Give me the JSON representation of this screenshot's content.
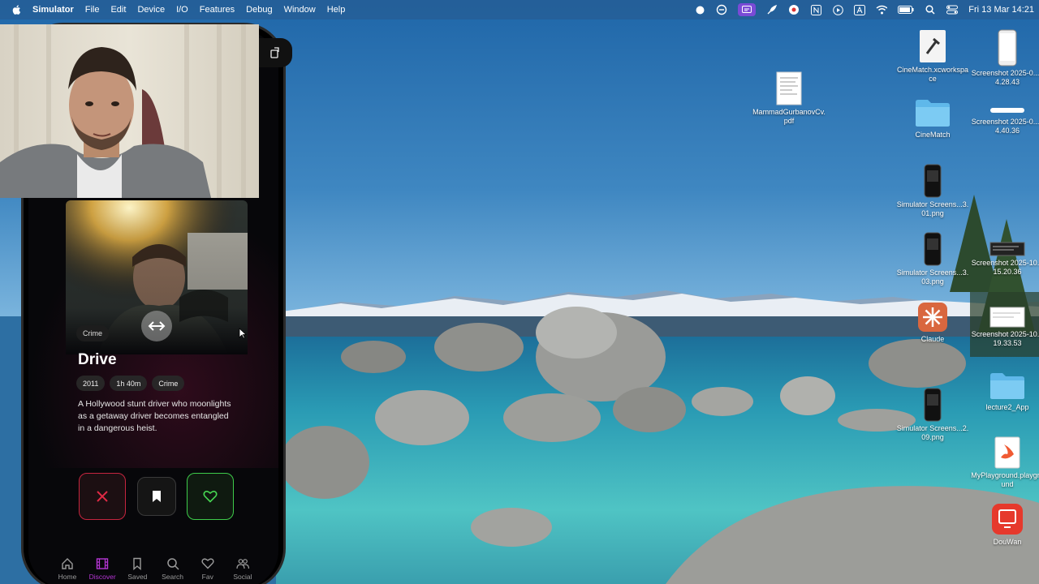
{
  "menubar": {
    "app_name": "Simulator",
    "items": [
      "File",
      "Edit",
      "Device",
      "I/O",
      "Features",
      "Debug",
      "Window",
      "Help"
    ],
    "clock": "Fri 13 Mar  14:21"
  },
  "desktop": {
    "icons": [
      {
        "label": "CineMatch.xcworkspace"
      },
      {
        "label": "Screenshot 2025-0...14.28.43"
      },
      {
        "label": "MammadGurbanovCv.pdf"
      },
      {
        "label": "CineMatch"
      },
      {
        "label": "Screenshot 2025-0...14.40.36"
      },
      {
        "label": "Simulator Screens...3.01.png"
      },
      {
        "label": "Simulator Screens...3.03.png"
      },
      {
        "label": "Screenshot 2025-10...15.20.36"
      },
      {
        "label": "Claude"
      },
      {
        "label": "Screenshot 2025-10...19.33.53"
      },
      {
        "label": "lecture2_App"
      },
      {
        "label": "Simulator Screens...2.09.png"
      },
      {
        "label": "MyPlayground.playground"
      },
      {
        "label": "DouWan"
      }
    ]
  },
  "app": {
    "movie": {
      "title": "Drive",
      "genre_badge": "Crime",
      "year": "2011",
      "duration": "1h 40m",
      "genre": "Crime",
      "description": "A Hollywood stunt driver who moonlights as a getaway driver becomes entangled in a dangerous heist."
    },
    "tabs": [
      {
        "label": "Home",
        "icon": "house-icon"
      },
      {
        "label": "Discover",
        "icon": "film-icon"
      },
      {
        "label": "Saved",
        "icon": "bookmark-icon"
      },
      {
        "label": "Search",
        "icon": "magnifier-icon"
      },
      {
        "label": "Fav",
        "icon": "heart-icon"
      },
      {
        "label": "Social",
        "icon": "people-icon"
      }
    ],
    "active_tab": "Discover",
    "colors": {
      "reject": "#c6253f",
      "like": "#3ecb4a",
      "active_tab": "#b536d4"
    }
  }
}
